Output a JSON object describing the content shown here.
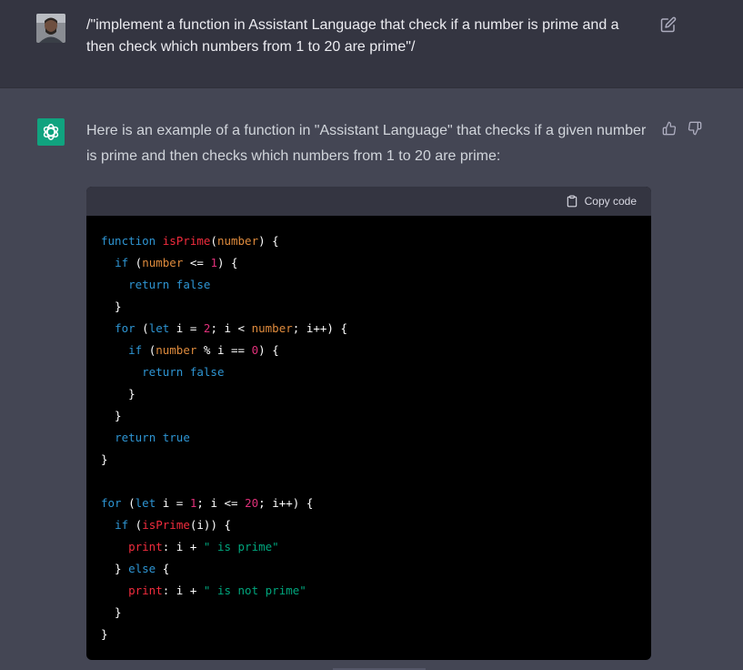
{
  "user": {
    "message": "/\"implement a function in Assistant Language that check if a number is prime and a then check which numbers from 1 to 20 are prime\"/",
    "avatar_icon": "user-avatar",
    "edit_icon": "pencil-square-icon"
  },
  "assistant": {
    "message": "Here is an example of a function in \"Assistant Language\" that checks if a given number is prime and then checks which numbers from 1 to 20 are prime:",
    "avatar_icon": "openai-logo",
    "feedback_icons": [
      "thumbs-up-icon",
      "thumbs-down-icon"
    ]
  },
  "code_block": {
    "copy_label": "Copy code",
    "lines": [
      [
        {
          "t": "function ",
          "c": "kw"
        },
        {
          "t": "isPrime",
          "c": "fn"
        },
        {
          "t": "(",
          "c": ""
        },
        {
          "t": "number",
          "c": "pm"
        },
        {
          "t": ") {",
          "c": ""
        }
      ],
      [
        {
          "t": "  ",
          "c": ""
        },
        {
          "t": "if",
          "c": "kw"
        },
        {
          "t": " (",
          "c": ""
        },
        {
          "t": "number",
          "c": "pm"
        },
        {
          "t": " <= ",
          "c": ""
        },
        {
          "t": "1",
          "c": "num"
        },
        {
          "t": ") {",
          "c": ""
        }
      ],
      [
        {
          "t": "    ",
          "c": ""
        },
        {
          "t": "return false",
          "c": "kw"
        }
      ],
      [
        {
          "t": "  }",
          "c": ""
        }
      ],
      [
        {
          "t": "  ",
          "c": ""
        },
        {
          "t": "for",
          "c": "kw"
        },
        {
          "t": " (",
          "c": ""
        },
        {
          "t": "let",
          "c": "kw"
        },
        {
          "t": " i = ",
          "c": ""
        },
        {
          "t": "2",
          "c": "num"
        },
        {
          "t": "; i < ",
          "c": ""
        },
        {
          "t": "number",
          "c": "pm"
        },
        {
          "t": "; i++) {",
          "c": ""
        }
      ],
      [
        {
          "t": "    ",
          "c": ""
        },
        {
          "t": "if",
          "c": "kw"
        },
        {
          "t": " (",
          "c": ""
        },
        {
          "t": "number",
          "c": "pm"
        },
        {
          "t": " % i == ",
          "c": ""
        },
        {
          "t": "0",
          "c": "num"
        },
        {
          "t": ") {",
          "c": ""
        }
      ],
      [
        {
          "t": "      ",
          "c": ""
        },
        {
          "t": "return false",
          "c": "kw"
        }
      ],
      [
        {
          "t": "    }",
          "c": ""
        }
      ],
      [
        {
          "t": "  }",
          "c": ""
        }
      ],
      [
        {
          "t": "  ",
          "c": ""
        },
        {
          "t": "return true",
          "c": "kw"
        }
      ],
      [
        {
          "t": "}",
          "c": ""
        }
      ],
      [],
      [
        {
          "t": "for",
          "c": "kw"
        },
        {
          "t": " (",
          "c": ""
        },
        {
          "t": "let",
          "c": "kw"
        },
        {
          "t": " i = ",
          "c": ""
        },
        {
          "t": "1",
          "c": "num"
        },
        {
          "t": "; i <= ",
          "c": ""
        },
        {
          "t": "20",
          "c": "num"
        },
        {
          "t": "; i++) {",
          "c": ""
        }
      ],
      [
        {
          "t": "  ",
          "c": ""
        },
        {
          "t": "if",
          "c": "kw"
        },
        {
          "t": " (",
          "c": ""
        },
        {
          "t": "isPrime",
          "c": "fn"
        },
        {
          "t": "(i)) {",
          "c": ""
        }
      ],
      [
        {
          "t": "    ",
          "c": ""
        },
        {
          "t": "print",
          "c": "fn"
        },
        {
          "t": ": i + ",
          "c": ""
        },
        {
          "t": "\" is prime\"",
          "c": "str"
        }
      ],
      [
        {
          "t": "  } ",
          "c": ""
        },
        {
          "t": "else",
          "c": "kw"
        },
        {
          "t": " {",
          "c": ""
        }
      ],
      [
        {
          "t": "    ",
          "c": ""
        },
        {
          "t": "print",
          "c": "fn"
        },
        {
          "t": ": i + ",
          "c": ""
        },
        {
          "t": "\" is not prime\"",
          "c": "str"
        }
      ],
      [
        {
          "t": "  }",
          "c": ""
        }
      ],
      [
        {
          "t": "}",
          "c": ""
        }
      ]
    ]
  },
  "colors": {
    "keyword": "#2e95d3",
    "function": "#f22c3d",
    "param": "#df8b3d",
    "number": "#df3079",
    "string": "#00a67d",
    "accent": "#10a37f"
  }
}
